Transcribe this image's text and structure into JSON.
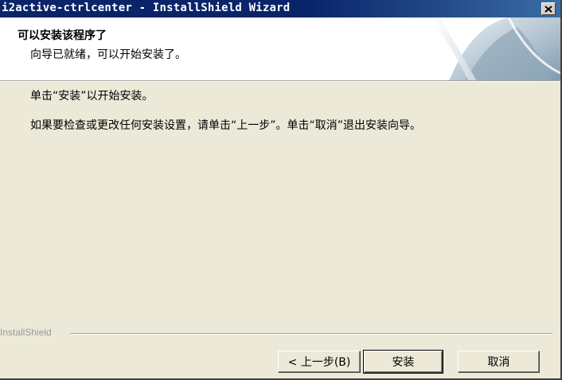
{
  "window": {
    "title": "i2active-ctrlcenter - InstallShield Wizard",
    "close_label": "×"
  },
  "header": {
    "title": "可以安装该程序了",
    "subtitle": "向导已就绪，可以开始安装了。"
  },
  "body": {
    "line1": "单击“安装”以开始安装。",
    "line2": "如果要检查或更改任何安装设置，请单击“上一步”。单击“取消”退出安装向导。"
  },
  "footer": {
    "brand": "InstallShield",
    "back_label": "< 上一步(B)",
    "install_label": "安装",
    "cancel_label": "取消"
  },
  "colors": {
    "titlebar": "#0a246a",
    "dialog": "#ece9d8",
    "header": "#ffffff"
  },
  "icons": {
    "close": "close-icon",
    "banner": "installshield-banner-graphic"
  }
}
